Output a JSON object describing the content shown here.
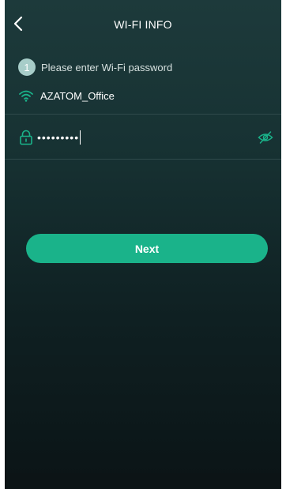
{
  "header": {
    "title": "WI-FI INFO",
    "back_icon": "chevron-left-icon"
  },
  "step": {
    "number": "1",
    "text": "Please enter Wi-Fi password"
  },
  "network": {
    "icon": "wifi-icon",
    "ssid": "AZATOM_Office"
  },
  "password": {
    "value": "•••••••••",
    "lock_icon": "lock-icon",
    "toggle_icon": "eye-off-icon"
  },
  "actions": {
    "next_label": "Next"
  },
  "colors": {
    "accent": "#1ab38a",
    "badge": "#a7cdc9",
    "background_top": "#1d3a3b",
    "background_bottom": "#0b1416"
  }
}
